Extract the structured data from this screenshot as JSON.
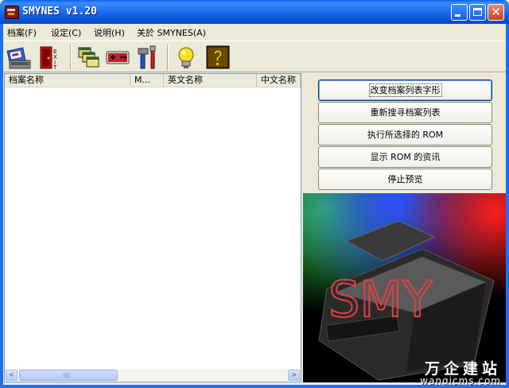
{
  "window": {
    "title": "SMYNES v1.20",
    "close_glyph": "✕"
  },
  "menu": [
    {
      "label": "档案(F)"
    },
    {
      "label": "设定(C)"
    },
    {
      "label": "说明(H)"
    },
    {
      "label": "关於 SMYNES(A)"
    }
  ],
  "toolbar": {
    "icons": [
      "rom-open-icon",
      "exit-door-icon",
      "windows-cascade-icon",
      "gamepad-icon",
      "tools-icon",
      "lightbulb-icon",
      "help-question-icon"
    ],
    "exit_label": "EXIT"
  },
  "list": {
    "columns": [
      "档案名称",
      "M...",
      "英文名称",
      "中文名称"
    ],
    "rows": []
  },
  "scroll": {
    "left_glyph": "<",
    "right_glyph": ">"
  },
  "actions": [
    {
      "label": "改变档案列表字形"
    },
    {
      "label": "重新搜寻档案列表"
    },
    {
      "label": "执行所选择的 ROM"
    },
    {
      "label": "显示 ROM 的资讯"
    },
    {
      "label": "停止预览"
    }
  ],
  "preview": {
    "logo_text": "SMY"
  },
  "watermark": {
    "cn": "万企建站",
    "en": "wangicms.com"
  },
  "colors": {
    "titlebar": "#0c54d8",
    "face": "#ece9d8",
    "list_border": "#7f9db9"
  }
}
